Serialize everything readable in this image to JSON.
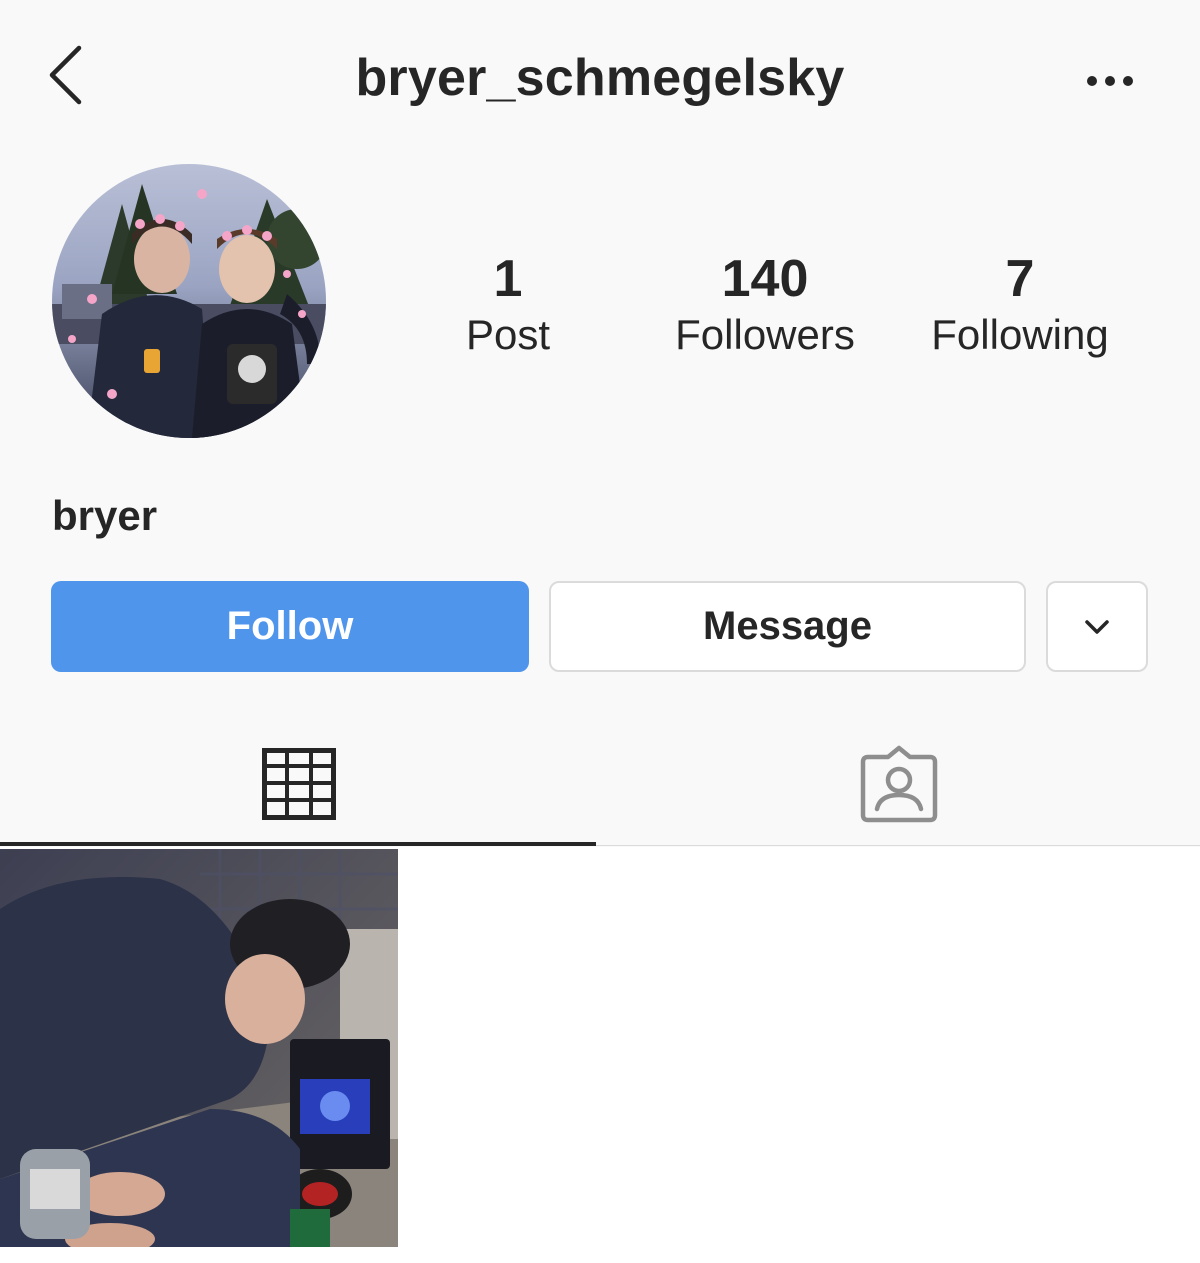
{
  "header": {
    "title": "bryer_schmegelsky",
    "back_icon": "chevron-left-icon",
    "more_icon": "more-horizontal-icon"
  },
  "profile": {
    "display_name": "bryer",
    "stats": {
      "posts": {
        "value": "1",
        "label": "Post"
      },
      "followers": {
        "value": "140",
        "label": "Followers"
      },
      "following": {
        "value": "7",
        "label": "Following"
      }
    }
  },
  "actions": {
    "follow_label": "Follow",
    "message_label": "Message",
    "suggest_icon": "chevron-down-icon"
  },
  "tabs": [
    {
      "icon": "grid-icon",
      "active": true
    },
    {
      "icon": "tagged-person-icon",
      "active": false
    }
  ],
  "posts_count_shown": 1,
  "colors": {
    "follow_button": "#4f95ec",
    "text": "#262626",
    "border": "#dbdbdb",
    "background": "#f9f9f9"
  }
}
